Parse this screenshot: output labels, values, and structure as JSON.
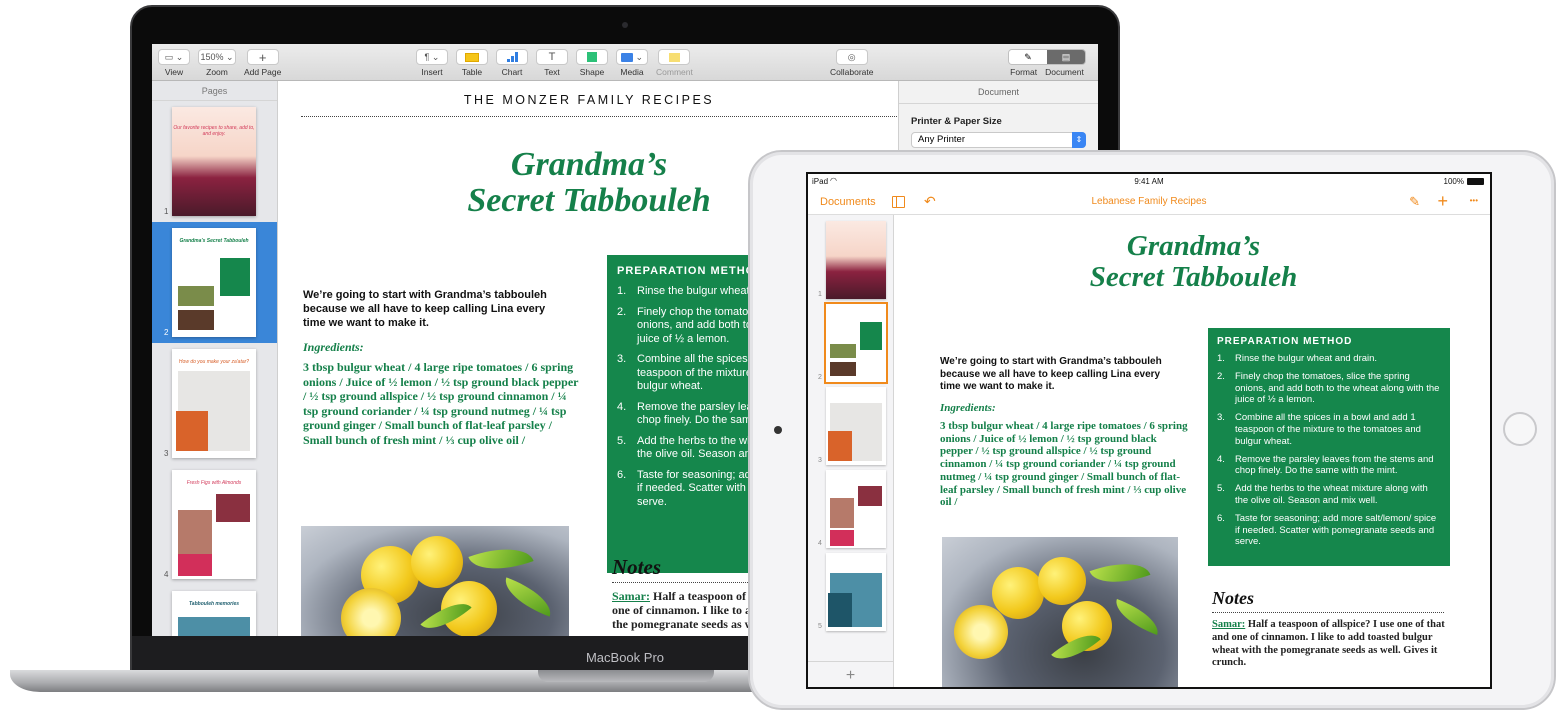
{
  "colors": {
    "recipe_green": "#15804a",
    "prep_box_green": "#15874c",
    "mac_selection_blue": "#3a86d8",
    "ipad_accent_orange": "#f08a1c"
  },
  "macbook": {
    "device_label": "MacBook Pro",
    "toolbar": {
      "view": {
        "label": "View",
        "icon": "sidebar-layout-icon"
      },
      "zoom": {
        "label": "Zoom",
        "value": "150%"
      },
      "add_page": {
        "label": "Add Page",
        "icon": "plus-icon"
      },
      "insert": {
        "label": "Insert",
        "icon": "pilcrow-icon"
      },
      "table": {
        "label": "Table",
        "icon": "table-icon"
      },
      "chart": {
        "label": "Chart",
        "icon": "bar-chart-icon"
      },
      "text": {
        "label": "Text",
        "icon": "text-t-icon"
      },
      "shape": {
        "label": "Shape",
        "icon": "square-shape-icon"
      },
      "media": {
        "label": "Media",
        "icon": "photo-icon"
      },
      "comment": {
        "label": "Comment",
        "icon": "comment-note-icon"
      },
      "collaborate": {
        "label": "Collaborate",
        "icon": "add-person-icon"
      },
      "format": {
        "label": "Format",
        "icon": "paintbrush-icon"
      },
      "document": {
        "label": "Document",
        "icon": "document-icon"
      }
    },
    "sidebar": {
      "title": "Pages",
      "pages": [
        {
          "number": "1",
          "caption": "Our favorite recipes to share, add to, and enjoy."
        },
        {
          "number": "2",
          "caption": "Grandma's Secret Tabbouleh",
          "selected": true
        },
        {
          "number": "3",
          "caption": "How do you make your za'atar?"
        },
        {
          "number": "4",
          "caption": "Fresh Figs with Almonds"
        },
        {
          "number": "5",
          "caption": "Tabbouleh memories"
        }
      ]
    },
    "inspector": {
      "title": "Document",
      "section": "Printer & Paper Size",
      "printer_value": "Any Printer"
    }
  },
  "recipe": {
    "header": "THE MONZER FAMILY RECIPES",
    "title_line1": "Grandma’s",
    "title_line2": "Secret Tabbouleh",
    "intro": "We’re going to start with Grandma’s tabbouleh because we all have to keep calling Lina every time we want to make it.",
    "ingredients_label": "Ingredients:",
    "ingredients": "3 tbsp bulgur wheat / 4 large ripe tomatoes / 6 spring onions / Juice of ½ lemon / ½ tsp ground black pepper / ½ tsp ground allspice / ½ tsp ground cinnamon / ¼ tsp ground coriander / ¼ tsp ground nutmeg / ¼ tsp ground ginger / Small bunch of flat-leaf parsley / Small bunch of fresh mint / ⅓ cup olive oil /",
    "prep_title": "PREPARATION METHOD",
    "steps": [
      {
        "n": "1.",
        "text": "Rinse the bulgur wheat and drain."
      },
      {
        "n": "2.",
        "text": "Finely chop the tomatoes, slice the spring onions, and add both to the wheat along with the juice of ½ a lemon."
      },
      {
        "n": "3.",
        "text": "Combine all the spices in a bowl and add 1 teaspoon of the mixture to the tomatoes and bulgur wheat."
      },
      {
        "n": "4.",
        "text": "Remove the parsley leaves from the stems and chop finely. Do the same with the mint."
      },
      {
        "n": "5.",
        "text": "Add the herbs to the wheat mixture along with the olive oil. Season and mix well."
      },
      {
        "n": "6.",
        "text": "Taste for seasoning; add more salt/lemon/ spice if needed. Scatter with pomegranate seeds and serve."
      }
    ],
    "notes_title": "Notes",
    "note_author": "Samar:",
    "note_text": " Half a teaspoon of allspice? I use one of that and one of cinnamon. I like to add toasted bulgur wheat with the pomegranate seeds as well. Gives it crunch."
  },
  "ipad": {
    "status": {
      "device": "iPad",
      "time": "9:41 AM",
      "battery": "100%"
    },
    "nav": {
      "documents": "Documents",
      "title": "Lebanese Family Recipes",
      "add_symbol": "+",
      "more_symbol": "•••"
    },
    "pages": [
      {
        "number": "1"
      },
      {
        "number": "2",
        "selected": true
      },
      {
        "number": "3"
      },
      {
        "number": "4"
      },
      {
        "number": "5"
      }
    ],
    "add_page_symbol": "+"
  }
}
